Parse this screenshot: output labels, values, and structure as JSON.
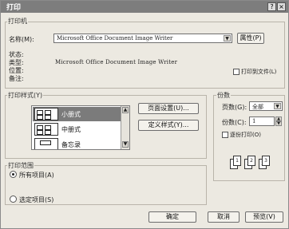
{
  "window": {
    "title": "打印",
    "help_button": "?",
    "close_button": "×"
  },
  "printer": {
    "group_label": "打印机",
    "name_label": "名称(M):",
    "name_value": "Microsoft Office Document Image Writer",
    "properties_button": "属性(P)",
    "status_label": "状态:",
    "type_label": "类型:",
    "type_value": "Microsoft Office Document Image Writer",
    "location_label": "位置:",
    "comment_label": "备注:",
    "print_to_file_label": "打印到文件(L)"
  },
  "print_style": {
    "group_label": "打印样式(Y)",
    "items": [
      {
        "label": "小册式"
      },
      {
        "label": "中册式"
      },
      {
        "label": "备忘录"
      }
    ],
    "selected_index": 0,
    "page_setup_button": "页面设置(U)...",
    "define_styles_button": "定义样式(Y)..."
  },
  "copies": {
    "group_label": "份数",
    "pages_label": "页数(G):",
    "pages_value": "全部",
    "copies_label": "份数(C):",
    "copies_value": "1",
    "collate_label": "逐份打印(O)",
    "page_icons": [
      "1",
      "2",
      "3"
    ]
  },
  "print_range": {
    "group_label": "打印范围",
    "all_items_label": "所有项目(A)",
    "selected_items_label": "选定项目(S)",
    "selected": "all"
  },
  "footer": {
    "ok_button": "确定",
    "cancel_button": "取消",
    "preview_button": "预览(V)"
  }
}
